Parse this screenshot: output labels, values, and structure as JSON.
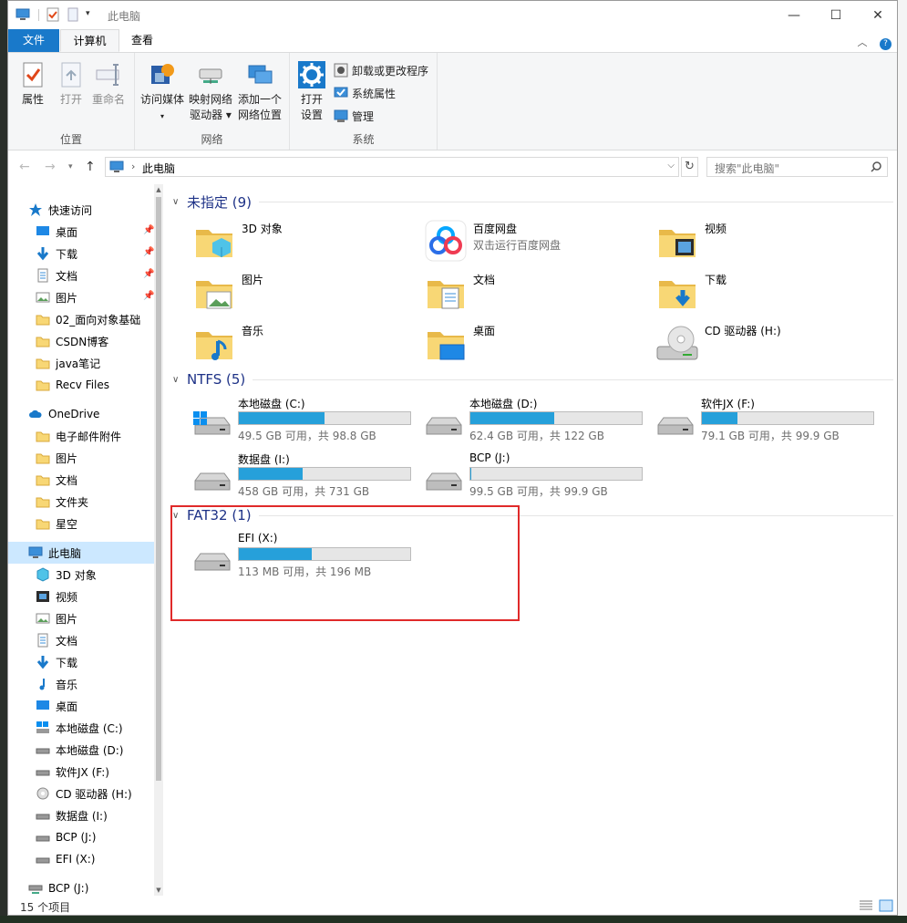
{
  "window": {
    "title": "此电脑",
    "buttons": {
      "minimize": "—",
      "maximize": "☐",
      "close": "✕"
    }
  },
  "ribbon": {
    "tabs": [
      {
        "label": "文件"
      },
      {
        "label": "计算机"
      },
      {
        "label": "查看"
      }
    ],
    "groups": {
      "location": {
        "label": "位置",
        "buttons": [
          {
            "label": "属性"
          },
          {
            "label": "打开"
          },
          {
            "label": "重命名"
          }
        ]
      },
      "network": {
        "label": "网络",
        "buttons": [
          {
            "label": "访问媒体"
          },
          {
            "label": "映射网络",
            "label2": "驱动器 ▾"
          },
          {
            "label": "添加一个",
            "label2": "网络位置"
          }
        ]
      },
      "system": {
        "label": "系统",
        "open_settings": {
          "label": "打开",
          "label2": "设置"
        },
        "items": [
          {
            "label": "卸载或更改程序"
          },
          {
            "label": "系统属性"
          },
          {
            "label": "管理"
          }
        ]
      }
    }
  },
  "address": {
    "path": "此电脑",
    "search_placeholder": "搜索\"此电脑\""
  },
  "nav": {
    "quick_access": "快速访问",
    "quick_items": [
      {
        "label": "桌面"
      },
      {
        "label": "下载"
      },
      {
        "label": "文档"
      },
      {
        "label": "图片"
      },
      {
        "label": "02_面向对象基础"
      },
      {
        "label": "CSDN博客"
      },
      {
        "label": "java笔记"
      },
      {
        "label": "Recv Files"
      }
    ],
    "onedrive": "OneDrive",
    "onedrive_items": [
      {
        "label": "电子邮件附件"
      },
      {
        "label": "图片"
      },
      {
        "label": "文档"
      },
      {
        "label": "文件夹"
      },
      {
        "label": "星空"
      }
    ],
    "this_pc": "此电脑",
    "pc_items": [
      {
        "label": "3D 对象"
      },
      {
        "label": "视频"
      },
      {
        "label": "图片"
      },
      {
        "label": "文档"
      },
      {
        "label": "下载"
      },
      {
        "label": "音乐"
      },
      {
        "label": "桌面"
      },
      {
        "label": "本地磁盘 (C:)"
      },
      {
        "label": "本地磁盘 (D:)"
      },
      {
        "label": "软件JX (F:)"
      },
      {
        "label": "CD 驱动器 (H:)"
      },
      {
        "label": "数据盘 (I:)"
      },
      {
        "label": "BCP (J:)"
      },
      {
        "label": "EFI (X:)"
      }
    ],
    "network_drive": "BCP (J:)"
  },
  "groups": {
    "unassigned": {
      "title": "未指定 (9)",
      "items": [
        {
          "name": "3D 对象",
          "icon": "folder-3d-icon"
        },
        {
          "name": "百度网盘",
          "sub": "双击运行百度网盘",
          "icon": "baidu-netdisk-icon"
        },
        {
          "name": "视频",
          "icon": "folder-video-icon"
        },
        {
          "name": "图片",
          "icon": "folder-pictures-icon"
        },
        {
          "name": "文档",
          "icon": "folder-documents-icon"
        },
        {
          "name": "下载",
          "icon": "folder-downloads-icon"
        },
        {
          "name": "音乐",
          "icon": "folder-music-icon"
        },
        {
          "name": "桌面",
          "icon": "folder-desktop-icon"
        },
        {
          "name": "CD 驱动器 (H:)",
          "icon": "cd-drive-icon"
        }
      ]
    },
    "ntfs": {
      "title": "NTFS (5)",
      "drives": [
        {
          "name": "本地磁盘 (C:)",
          "info": "49.5 GB 可用，共 98.8 GB",
          "used_fraction": 0.499
        },
        {
          "name": "本地磁盘 (D:)",
          "info": "62.4 GB 可用，共 122 GB",
          "used_fraction": 0.489
        },
        {
          "name": "软件JX (F:)",
          "info": "79.1 GB 可用，共 99.9 GB",
          "used_fraction": 0.208
        },
        {
          "name": "数据盘 (I:)",
          "info": "458 GB 可用，共 731 GB",
          "used_fraction": 0.373
        },
        {
          "name": "BCP (J:)",
          "info": "99.5 GB 可用，共 99.9 GB",
          "used_fraction": 0.004
        }
      ]
    },
    "fat32": {
      "title": "FAT32 (1)",
      "drives": [
        {
          "name": "EFI (X:)",
          "info": "113 MB 可用，共 196 MB",
          "used_fraction": 0.423
        }
      ]
    }
  },
  "status": {
    "count": "15 个项目"
  },
  "colors": {
    "accent": "#1979ca",
    "bar_fill": "#26a0da",
    "highlight_box": "#e02a2a",
    "group_title": "#1e3287"
  }
}
